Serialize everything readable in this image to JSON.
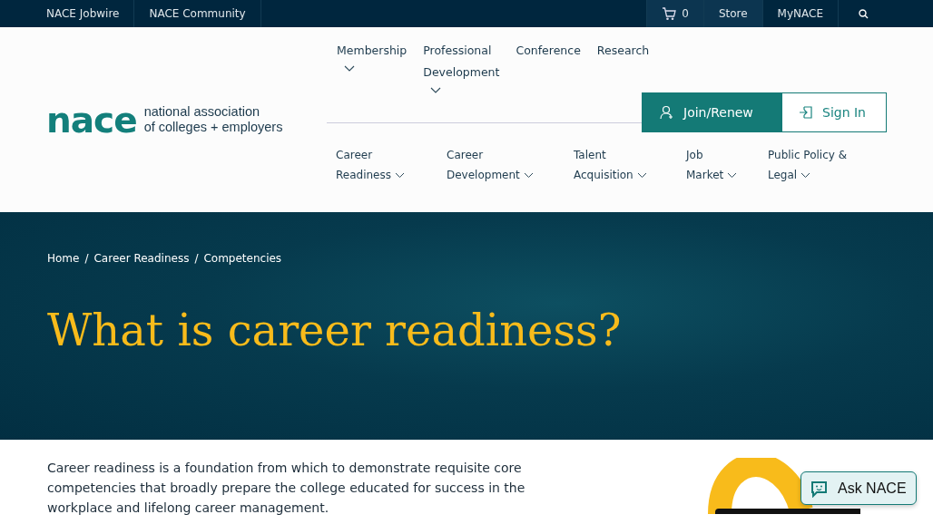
{
  "utility_bar": {
    "links": [
      "NACE Jobwire",
      "NACE Community"
    ],
    "cart_count": "0",
    "right_links": [
      "Store",
      "MyNACE"
    ]
  },
  "logo": {
    "mark": "nace",
    "tagline_1": "national association",
    "tagline_2": "of colleges + employers"
  },
  "top_nav": [
    {
      "label_1": "Membership",
      "caret": true
    },
    {
      "label_1": "Professional",
      "label_2": "Development",
      "caret": true
    },
    {
      "label_1": "Conference",
      "caret": false
    },
    {
      "label_1": "Research",
      "caret": false
    }
  ],
  "account_buttons": {
    "join": "Join/Renew",
    "sign_in": "Sign In"
  },
  "topic_nav": [
    {
      "label_1": "Career",
      "label_2": "Readiness"
    },
    {
      "label_1": "Career",
      "label_2": "Development"
    },
    {
      "label_1": "Talent",
      "label_2": "Acquisition"
    },
    {
      "label_1": "Job",
      "label_2": "Market"
    },
    {
      "label_1": "Public Policy &",
      "label_2": "Legal"
    }
  ],
  "breadcrumb": {
    "separator": "/",
    "items": [
      "Home",
      "Career Readiness",
      "Competencies"
    ]
  },
  "hero_title": "What is career readiness?",
  "intro": "Career readiness is a foundation from which to demonstrate requisite core competencies that broadly prepare the college educated for success in the workplace and lifelong career management.",
  "chat_button": "Ask NACE"
}
